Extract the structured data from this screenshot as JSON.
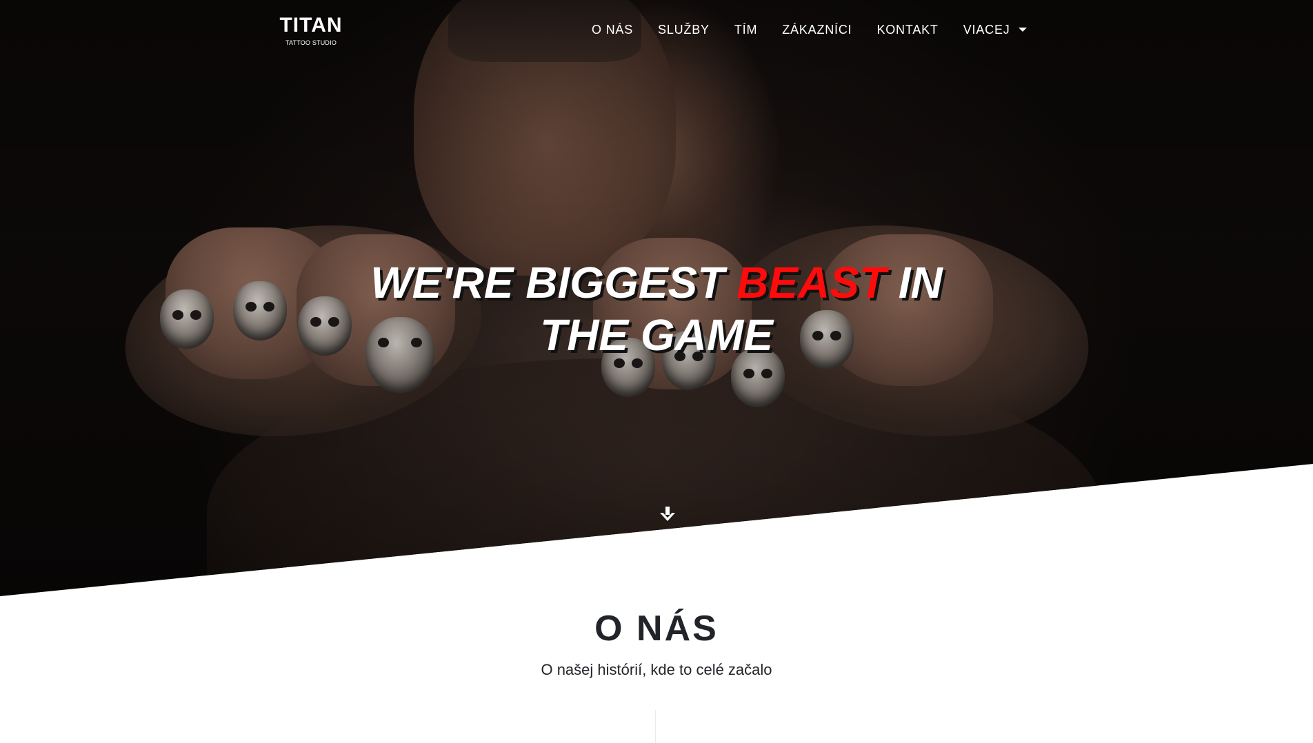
{
  "brand": {
    "title": "TITAN",
    "subtitle": "TATTOO STUDIO"
  },
  "nav": {
    "items": [
      {
        "label": "O NÁS"
      },
      {
        "label": "SLUŽBY"
      },
      {
        "label": "TÍM"
      },
      {
        "label": "ZÁKAZNÍCI"
      },
      {
        "label": "KONTAKT"
      },
      {
        "label": "VIACEJ",
        "has_dropdown": true
      }
    ]
  },
  "hero": {
    "headline_part1": "WE'RE BIGGEST",
    "headline_accent": "BEAST",
    "headline_part2": "IN THE GAME",
    "accent_color": "#ff0b0b",
    "scroll_icon": "arrow-down-icon"
  },
  "about": {
    "title": "O NÁS",
    "subtitle": "O našej histórií, kde to celé začalo"
  },
  "colors": {
    "hero_background": "#130e0d",
    "text_light": "#ffffff",
    "text_dark": "#212529",
    "accent": "#ff0b0b"
  }
}
